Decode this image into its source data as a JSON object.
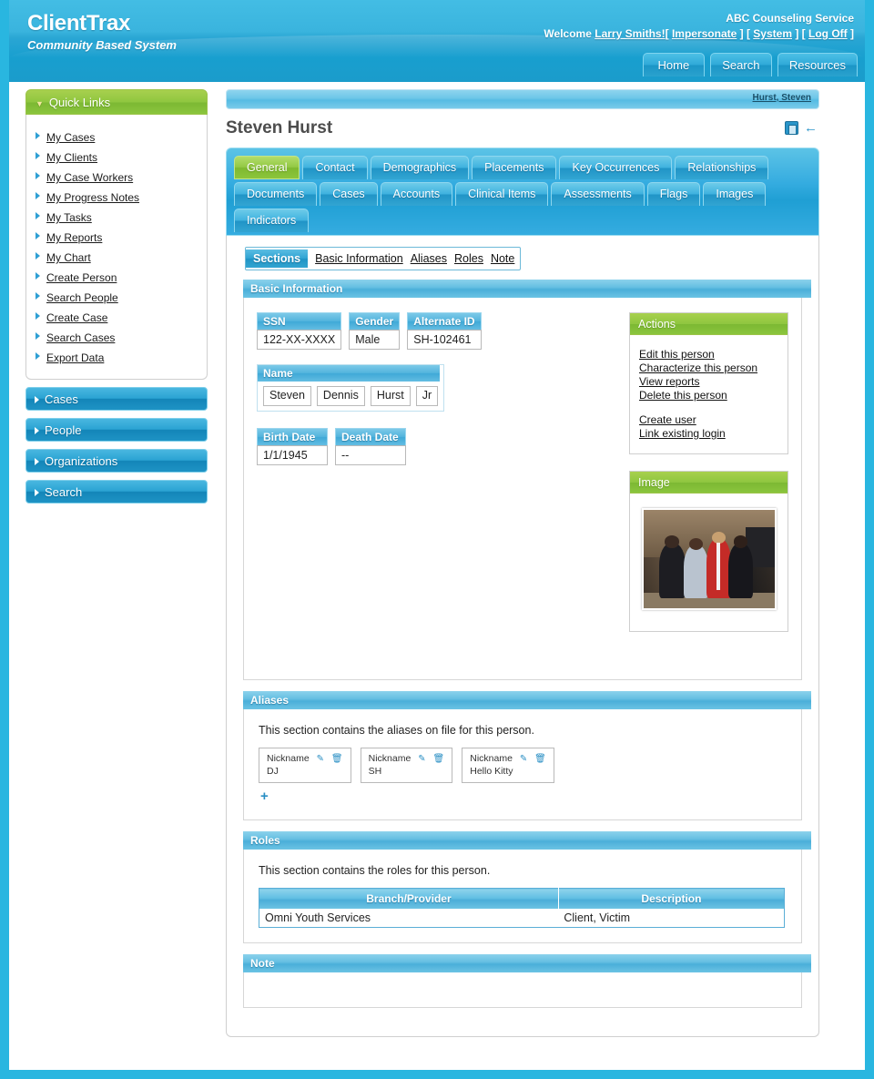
{
  "header": {
    "brand_title": "ClientTrax",
    "brand_subtitle": "Community Based System",
    "org": "ABC Counseling Service",
    "welcome_prefix": "Welcome ",
    "user": "Larry Smiths!",
    "bracket_open": "[ ",
    "impersonate": "Impersonate",
    "sep1": " ] [ ",
    "system": "System",
    "sep2": " ] [ ",
    "logoff": "Log Off",
    "bracket_close": " ]",
    "nav": [
      {
        "label": "Home"
      },
      {
        "label": "Search"
      },
      {
        "label": "Resources"
      }
    ]
  },
  "sidebar": {
    "quick_links_title": "Quick Links",
    "quick_links": [
      {
        "label": "My Cases"
      },
      {
        "label": "My Clients"
      },
      {
        "label": "My Case Workers"
      },
      {
        "label": "My Progress Notes"
      },
      {
        "label": "My Tasks"
      },
      {
        "label": "My Reports"
      },
      {
        "label": "My Chart"
      },
      {
        "label": "Create Person"
      },
      {
        "label": "Search People"
      },
      {
        "label": "Create Case"
      },
      {
        "label": "Search Cases"
      },
      {
        "label": "Export Data"
      }
    ],
    "sections": [
      {
        "label": "Cases"
      },
      {
        "label": "People"
      },
      {
        "label": "Organizations"
      },
      {
        "label": "Search"
      }
    ]
  },
  "main": {
    "breadcrumb": "Hurst, Steven",
    "page_title": "Steven Hurst",
    "title_icons": [
      {
        "name": "copy-icon"
      },
      {
        "name": "back-arrow-icon"
      }
    ],
    "tabs_row1": [
      {
        "label": "General",
        "active": true
      },
      {
        "label": "Contact",
        "active": false
      },
      {
        "label": "Demographics",
        "active": false
      },
      {
        "label": "Placements",
        "active": false
      },
      {
        "label": "Key Occurrences",
        "active": false
      },
      {
        "label": "Relationships",
        "active": false
      }
    ],
    "tabs_row2": [
      {
        "label": "Documents"
      },
      {
        "label": "Cases"
      },
      {
        "label": "Accounts"
      },
      {
        "label": "Clinical Items"
      },
      {
        "label": "Assessments"
      },
      {
        "label": "Flags"
      },
      {
        "label": "Images"
      }
    ],
    "tabs_row3": [
      {
        "label": "Indicators"
      }
    ],
    "sections_nav": {
      "label": "Sections",
      "links": [
        {
          "label": "Basic Information"
        },
        {
          "label": "Aliases"
        },
        {
          "label": "Roles"
        },
        {
          "label": "Note"
        }
      ]
    },
    "basic_information": {
      "heading": "Basic Information",
      "ssn_label": "SSN",
      "ssn_value": "122-XX-XXXX",
      "gender_label": "Gender",
      "gender_value": "Male",
      "alt_id_label": "Alternate ID",
      "alt_id_value": "SH-102461",
      "name_label": "Name",
      "name_parts": [
        "Steven",
        "Dennis",
        "Hurst",
        "Jr"
      ],
      "birth_label": "Birth Date",
      "birth_value": "1/1/1945",
      "death_label": "Death Date",
      "death_value": "--"
    },
    "actions": {
      "heading": "Actions",
      "group1": [
        {
          "label": "Edit this person"
        },
        {
          "label": "Characterize this person"
        },
        {
          "label": "View reports"
        },
        {
          "label": "Delete this person"
        }
      ],
      "group2": [
        {
          "label": "Create user"
        },
        {
          "label": "Link existing login"
        }
      ]
    },
    "image_panel": {
      "heading": "Image"
    },
    "aliases": {
      "heading": "Aliases",
      "description": "This section contains the aliases on file for this person.",
      "items": [
        {
          "type": "Nickname",
          "value": "DJ"
        },
        {
          "type": "Nickname",
          "value": "SH"
        },
        {
          "type": "Nickname",
          "value": "Hello Kitty"
        }
      ],
      "add_label": "+"
    },
    "roles": {
      "heading": "Roles",
      "description": "This section contains the roles for this person.",
      "columns": [
        "Branch/Provider",
        "Description"
      ],
      "rows": [
        [
          "Omni Youth Services",
          "Client, Victim"
        ]
      ]
    },
    "note": {
      "heading": "Note",
      "value": ""
    }
  },
  "colors": {
    "page_border": "#29b6e0",
    "header_blue": "#2aa6d4",
    "accent_green": "#8ec63f",
    "section_blue": "#66bfe2",
    "link_dark": "#1b1b1b"
  }
}
